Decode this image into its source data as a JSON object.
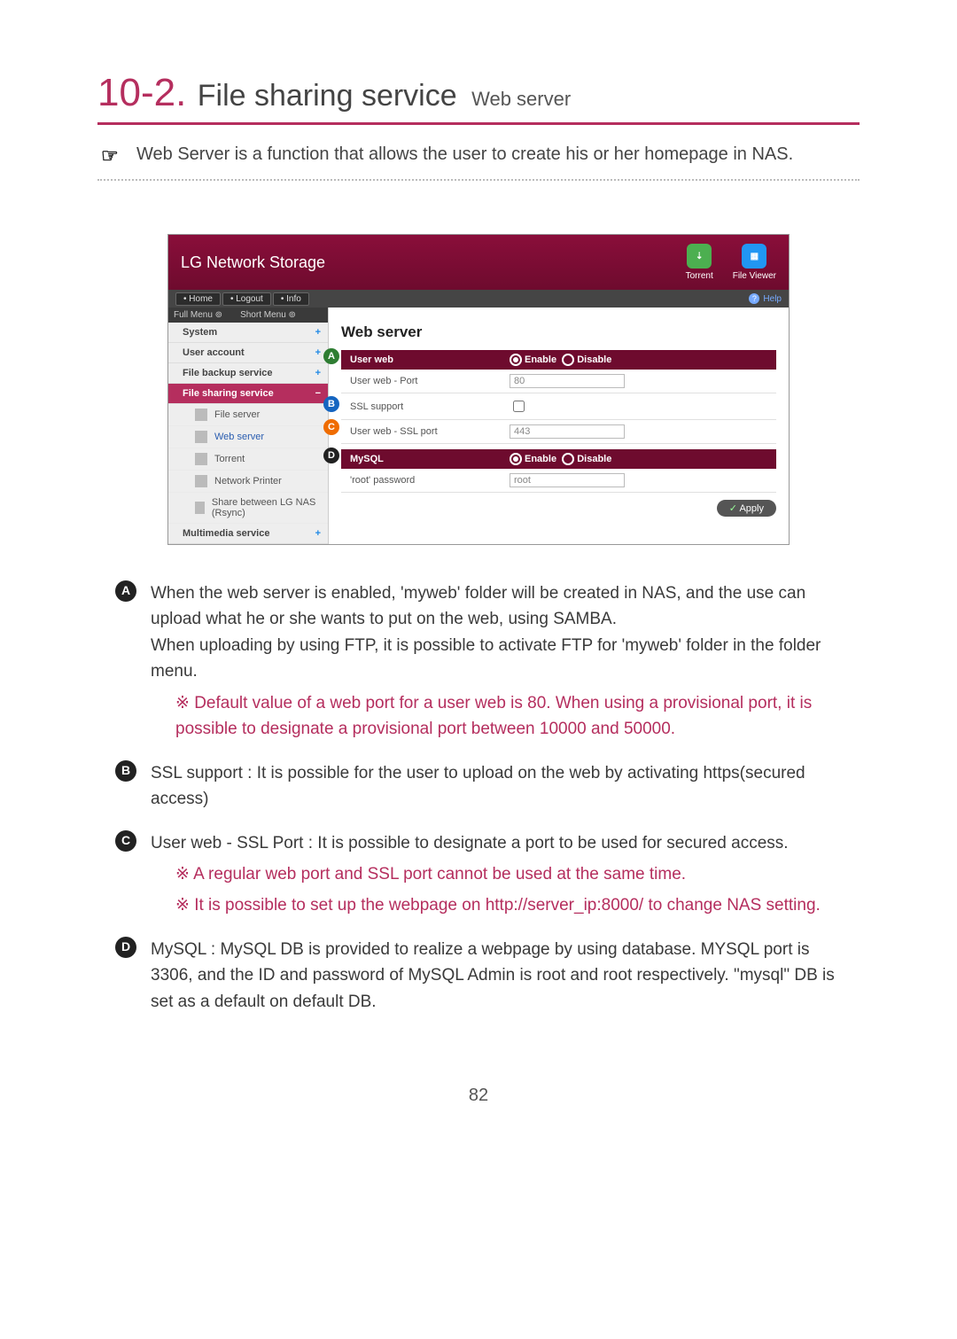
{
  "title": {
    "num": "10-2.",
    "main": "File sharing service",
    "sub": "Web server"
  },
  "intro": "Web Server is a function that allows the user to create his or her homepage in NAS.",
  "ui": {
    "brand": "LG Network Storage",
    "hdr_icons": [
      {
        "name": "Torrent",
        "cls": "t",
        "glyph": "⇣"
      },
      {
        "name": "File Viewer",
        "cls": "f",
        "glyph": "▦"
      }
    ],
    "nav": [
      "• Home",
      "• Logout",
      "• Info"
    ],
    "help": "Help",
    "menu_tabs": [
      "Full Menu ⊚",
      "Short Menu ⊚"
    ],
    "side": [
      {
        "t": "System",
        "type": "hdr",
        "ic": "ic-sys"
      },
      {
        "t": "User account",
        "type": "hdr",
        "ic": "ic-usr"
      },
      {
        "t": "File backup service",
        "type": "hdr",
        "ic": "ic-bak"
      },
      {
        "t": "File sharing service",
        "type": "sel",
        "ic": "ic-shr"
      },
      {
        "t": "File server",
        "type": "sub"
      },
      {
        "t": "Web server",
        "type": "sub",
        "hl": true
      },
      {
        "t": "Torrent",
        "type": "sub"
      },
      {
        "t": "Network Printer",
        "type": "sub"
      },
      {
        "t": "Share between LG NAS (Rsync)",
        "type": "sub"
      },
      {
        "t": "Multimedia service",
        "type": "hdr",
        "ic": "ic-mm"
      }
    ],
    "panel_title": "Web server",
    "userweb": {
      "hdr": "User web",
      "enable": "Enable",
      "disable": "Disable",
      "rows": [
        {
          "lab": "User web - Port",
          "val": "80",
          "type": "text"
        },
        {
          "lab": "SSL support",
          "val": "",
          "type": "check"
        },
        {
          "lab": "User web - SSL port",
          "val": "443",
          "type": "text"
        }
      ]
    },
    "mysql": {
      "hdr": "MySQL",
      "enable": "Enable",
      "disable": "Disable",
      "rows": [
        {
          "lab": "'root' password",
          "val": "root",
          "type": "text"
        }
      ]
    },
    "apply": "Apply",
    "markers": [
      "A",
      "B",
      "C",
      "D"
    ]
  },
  "desc": {
    "A": {
      "p1": "When the web server is enabled, 'myweb' folder will be created in NAS, and the use can upload what he or she wants to put on the web, using SAMBA.",
      "p2": "When uploading by using FTP, it is possible to activate FTP for 'myweb' folder in the folder menu.",
      "note": "Default value of a web port for a user web is 80.  When using a provisional port, it is possible to designate a provisional port between 10000 and 50000."
    },
    "B": "SSL support : It is possible for the user to upload on the web by activating https(secured access)",
    "C": {
      "p": "User web - SSL Port : It is possible to designate a port to be used for secured access.",
      "n1": "A regular web port and SSL port cannot be used at the same time.",
      "n2": "It is possible to set up the webpage on http://server_ip:8000/  to change NAS setting."
    },
    "D": "MySQL : MySQL DB is provided to realize a webpage by using database. MYSQL port is 3306, and the ID and password of MySQL Admin is root and root respectively. \"mysql\" DB is set as a default on default DB."
  },
  "page": "82"
}
